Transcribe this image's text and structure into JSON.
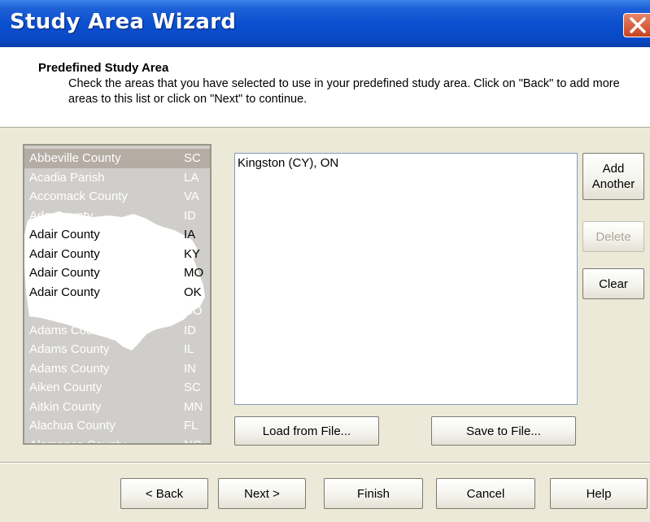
{
  "window": {
    "title": "Study Area Wizard"
  },
  "header": {
    "title": "Predefined Study Area",
    "description": "Check the areas that you have selected to use in your predefined study area.  Click on \"Back\" to add more areas to this list or click on \"Next\" to continue."
  },
  "area_list": {
    "items": [
      {
        "name": "Abbeville County",
        "state": "SC",
        "selected": true
      },
      {
        "name": "Acadia Parish",
        "state": "LA"
      },
      {
        "name": "Accomack County",
        "state": "VA"
      },
      {
        "name": "Ada County",
        "state": "ID"
      },
      {
        "name": "Adair County",
        "state": "IA"
      },
      {
        "name": "Adair County",
        "state": "KY"
      },
      {
        "name": "Adair County",
        "state": "MO"
      },
      {
        "name": "Adair County",
        "state": "OK"
      },
      {
        "name": "Adams County",
        "state": "CO"
      },
      {
        "name": "Adams County",
        "state": "ID"
      },
      {
        "name": "Adams County",
        "state": "IL"
      },
      {
        "name": "Adams County",
        "state": "IN"
      },
      {
        "name": "Aiken County",
        "state": "SC"
      },
      {
        "name": "Aitkin County",
        "state": "MN"
      },
      {
        "name": "Alachua County",
        "state": "FL"
      },
      {
        "name": "Alamance County",
        "state": "NC"
      }
    ]
  },
  "selected_list": {
    "items": [
      "Kingston (CY), ON"
    ]
  },
  "side_buttons": {
    "add_another": "Add Another",
    "delete": "Delete",
    "clear": "Clear"
  },
  "file_buttons": {
    "load": "Load from File...",
    "save": "Save to File..."
  },
  "footer": {
    "back": "< Back",
    "next": "Next >",
    "finish": "Finish",
    "cancel": "Cancel",
    "help": "Help"
  },
  "colors": {
    "titlebar": "#0b50d0",
    "dialog_bg": "#ece9d8",
    "close_button": "#c9421e"
  }
}
